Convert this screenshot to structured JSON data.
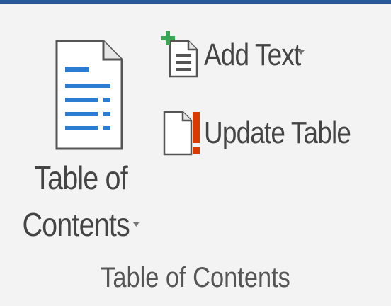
{
  "ribbon": {
    "accent_color": "#2b579a",
    "group_label": "Table of Contents",
    "toc_button": {
      "line1": "Table of",
      "line2": "Contents",
      "icon": "document-list-icon",
      "has_dropdown": true
    },
    "add_text": {
      "label": "Add Text",
      "icon": "add-text-icon",
      "has_dropdown": true
    },
    "update_table": {
      "label": "Update Table",
      "icon": "update-table-icon"
    }
  }
}
